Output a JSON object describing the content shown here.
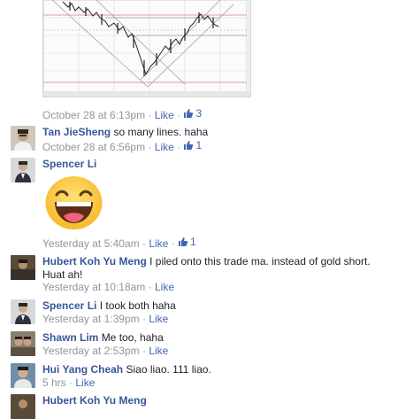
{
  "labels": {
    "like": "Like",
    "dot": "·"
  },
  "first_comment": {
    "timestamp": "October 28 at 6:13pm",
    "likes": "3"
  },
  "comments": [
    {
      "author": "Tan JieSheng",
      "text": "so many lines. haha",
      "timestamp": "October 28 at 6:56pm",
      "likes": "1"
    },
    {
      "author": "Spencer Li",
      "text": "",
      "timestamp": "Yesterday at 5:40am",
      "likes": "1",
      "sticker": "laughing-face-sticker"
    },
    {
      "author": "Hubert Koh Yu Meng",
      "text": "I piled onto this trade ma. instead of gold short. Huat ah!",
      "timestamp": "Yesterday at 10:18am",
      "likes": ""
    },
    {
      "author": "Spencer Li",
      "text": "I took both haha",
      "timestamp": "Yesterday at 1:39pm",
      "likes": ""
    },
    {
      "author": "Shawn Lim",
      "text": "Me too, haha",
      "timestamp": "Yesterday at 2:53pm",
      "likes": ""
    },
    {
      "author": "Hui Yang Cheah",
      "text": "Siao liao. 111 liao.",
      "timestamp": "5 hrs",
      "likes": ""
    },
    {
      "author": "Hubert Koh Yu Meng",
      "text": "",
      "timestamp": "",
      "likes": ""
    }
  ],
  "colors": {
    "link": "#4267b2",
    "author": "#365899",
    "meta": "#90949c",
    "text": "#1d2129"
  },
  "icons": {
    "like": "thumbs-up-icon"
  }
}
